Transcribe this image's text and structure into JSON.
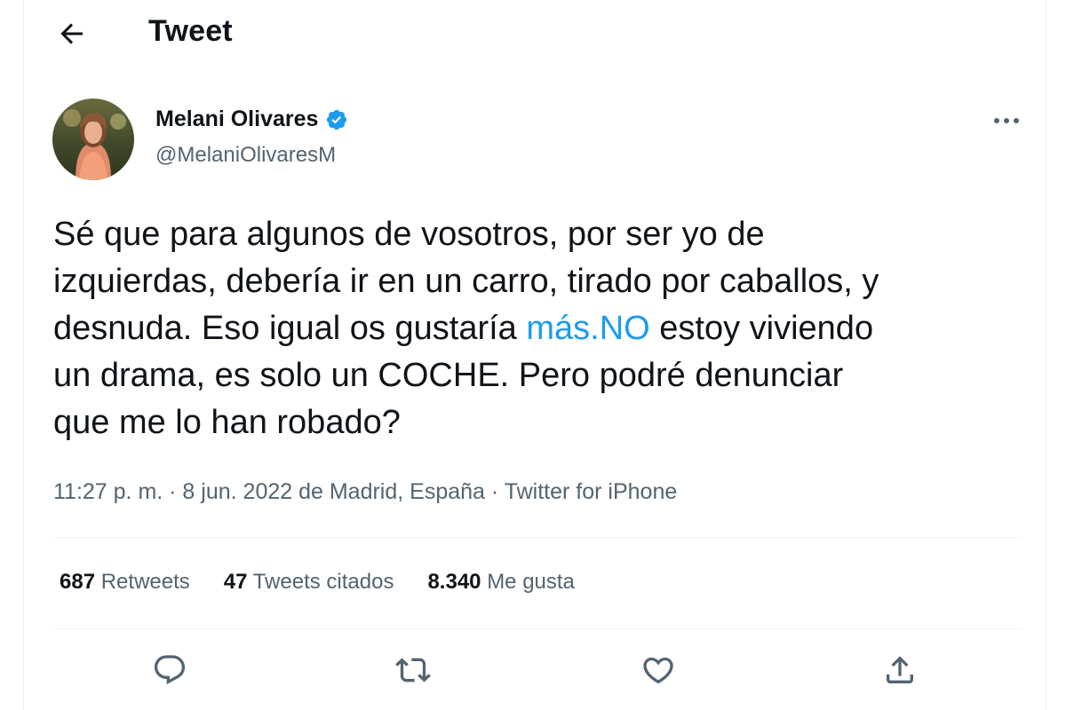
{
  "header": {
    "title": "Tweet",
    "back_icon": "arrow-left-icon"
  },
  "author": {
    "name": "Melani Olivares",
    "handle": "@MelaniOlivaresM",
    "verified_icon": "verified-badge-icon",
    "avatar_icon": "avatar-photo"
  },
  "tweet": {
    "text_before": "Sé que para algunos de vosotros, por ser yo de\nizquierdas, debería ir en un carro, tirado por caballos, y\ndesnuda. Eso igual os gustaría ",
    "link": "más.NO",
    "text_after": " estoy viviendo\nun drama, es solo un COCHE. Pero podré denunciar\nque me lo han robado?",
    "meta": "11:27 p. m. · 8 jun. 2022 de Madrid, España · Twitter for iPhone"
  },
  "stats": {
    "retweets_count": "687",
    "retweets_label": "Retweets",
    "quotes_count": "47",
    "quotes_label": "Tweets citados",
    "likes_count": "8.340",
    "likes_label": "Me gusta"
  },
  "actions": [
    "reply-icon",
    "retweet-icon",
    "like-icon",
    "share-icon"
  ],
  "colors": {
    "accent": "#1d9bf0",
    "text": "#0f1419",
    "secondary": "#536471",
    "divider": "#eff3f4"
  }
}
